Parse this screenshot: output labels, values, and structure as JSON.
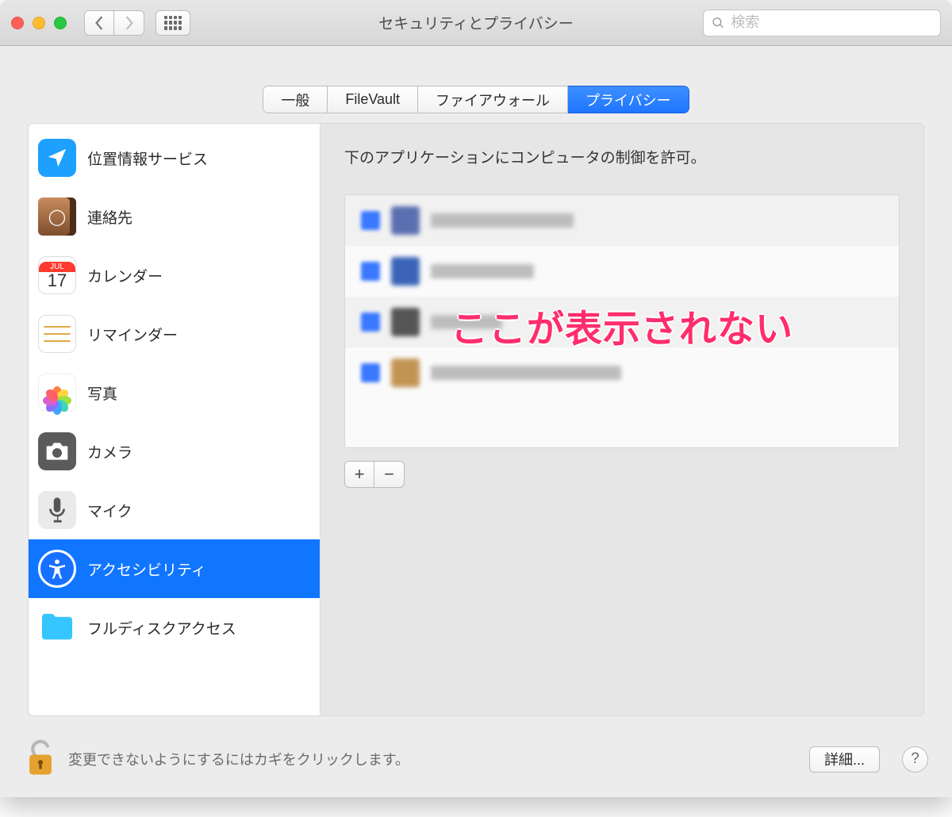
{
  "window": {
    "title": "セキュリティとプライバシー"
  },
  "search": {
    "placeholder": "検索"
  },
  "tabs": [
    {
      "label": "一般",
      "active": false
    },
    {
      "label": "FileVault",
      "active": false
    },
    {
      "label": "ファイアウォール",
      "active": false
    },
    {
      "label": "プライバシー",
      "active": true
    }
  ],
  "sidebar": {
    "items": [
      {
        "label": "位置情報サービス",
        "icon": "location"
      },
      {
        "label": "連絡先",
        "icon": "contacts"
      },
      {
        "label": "カレンダー",
        "icon": "calendar",
        "badge_top": "JUL",
        "badge_day": "17"
      },
      {
        "label": "リマインダー",
        "icon": "reminders"
      },
      {
        "label": "写真",
        "icon": "photos"
      },
      {
        "label": "カメラ",
        "icon": "camera"
      },
      {
        "label": "マイク",
        "icon": "microphone"
      },
      {
        "label": "アクセシビリティ",
        "icon": "accessibility",
        "selected": true
      },
      {
        "label": "フルディスクアクセス",
        "icon": "folder"
      }
    ]
  },
  "detail": {
    "description": "下のアプリケーションにコンピュータの制御を許可。",
    "annotation_overlay": "ここが表示されない",
    "add_label": "+",
    "remove_label": "−"
  },
  "footer": {
    "lock_text": "変更できないようにするにはカギをクリックします。",
    "advanced_label": "詳細...",
    "help_label": "?"
  }
}
